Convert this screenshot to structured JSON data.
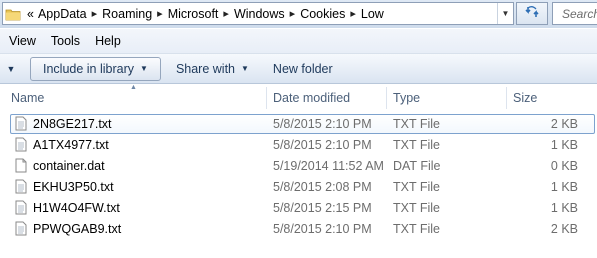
{
  "address": {
    "overflow_label": "«",
    "breadcrumbs": [
      "AppData",
      "Roaming",
      "Microsoft",
      "Windows",
      "Cookies",
      "Low"
    ],
    "refresh_icon": "refresh-icon"
  },
  "search": {
    "placeholder": "Search"
  },
  "menu": {
    "items": [
      "View",
      "Tools",
      "Help"
    ]
  },
  "toolbar": {
    "include_label": "Include in library",
    "share_label": "Share with",
    "newfolder_label": "New folder"
  },
  "columns": {
    "name": "Name",
    "date": "Date modified",
    "type": "Type",
    "size": "Size"
  },
  "files": [
    {
      "name": "2N8GE217.txt",
      "date": "5/8/2015 2:10 PM",
      "type": "TXT File",
      "size": "2 KB",
      "icon": "text-file-icon"
    },
    {
      "name": "A1TX4977.txt",
      "date": "5/8/2015 2:10 PM",
      "type": "TXT File",
      "size": "1 KB",
      "icon": "text-file-icon"
    },
    {
      "name": "container.dat",
      "date": "5/19/2014 11:52 AM",
      "type": "DAT File",
      "size": "0 KB",
      "icon": "blank-file-icon"
    },
    {
      "name": "EKHU3P50.txt",
      "date": "5/8/2015 2:08 PM",
      "type": "TXT File",
      "size": "1 KB",
      "icon": "text-file-icon"
    },
    {
      "name": "H1W4O4FW.txt",
      "date": "5/8/2015 2:15 PM",
      "type": "TXT File",
      "size": "1 KB",
      "icon": "text-file-icon"
    },
    {
      "name": "PPWQGAB9.txt",
      "date": "5/8/2015 2:10 PM",
      "type": "TXT File",
      "size": "2 KB",
      "icon": "text-file-icon"
    }
  ],
  "colors": {
    "accent": "#1e395b",
    "focus_border": "#7da2ce",
    "folder": "#e8c454"
  }
}
